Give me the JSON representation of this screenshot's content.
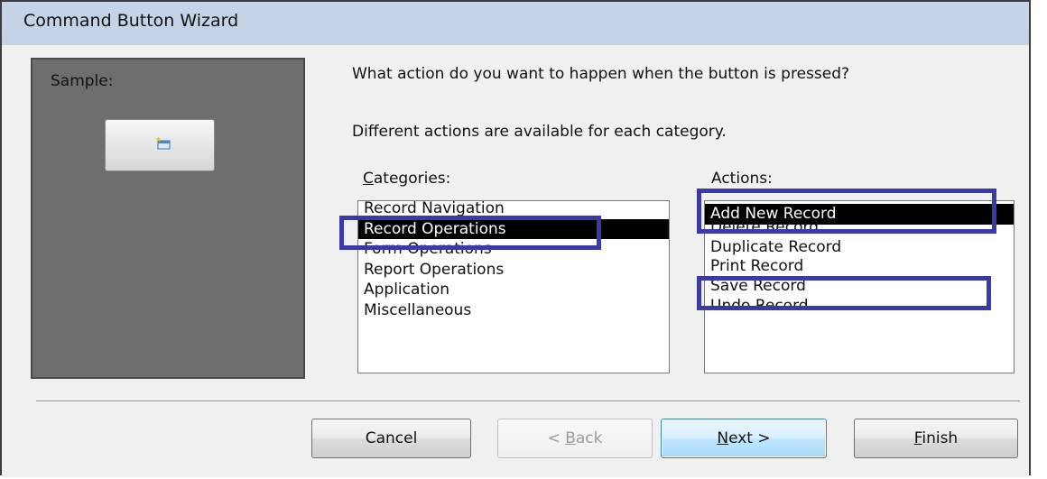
{
  "window": {
    "title": "Command Button Wizard"
  },
  "sample": {
    "label": "Sample:",
    "button_icon": "new-record-icon"
  },
  "prompt": {
    "question": "What action do you want to happen when the button is pressed?",
    "hint": "Different actions are available for each category."
  },
  "categories": {
    "label_mnemonic": "C",
    "label_rest": "ategories:",
    "items": [
      "Record Navigation",
      "Record Operations",
      "Form Operations",
      "Report Operations",
      "Application",
      "Miscellaneous"
    ],
    "selected": "Record Operations"
  },
  "actions": {
    "label": "Actions:",
    "items": [
      "Add New Record",
      "Delete Record",
      "Duplicate Record",
      "Print Record",
      "Save Record",
      "Undo Record"
    ],
    "selected": "Add New Record"
  },
  "buttons": {
    "cancel": "Cancel",
    "back_prefix": "< ",
    "back_mnemonic": "B",
    "back_rest": "ack",
    "next_mnemonic": "N",
    "next_rest": "ext >",
    "finish_mnemonic": "F",
    "finish_rest": "inish"
  },
  "colors": {
    "highlight_box": "#3a3aa6",
    "selection": "#000000",
    "sample_panel": "#6e6e6e"
  }
}
